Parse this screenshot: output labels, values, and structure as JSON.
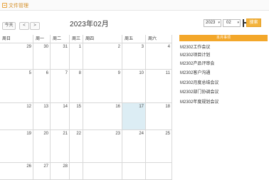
{
  "window": {
    "title": "文件管理"
  },
  "nav": {
    "today": "今天",
    "prev": "<",
    "next": ">"
  },
  "calendar": {
    "title": "2023年02月",
    "weekdays": [
      "周日",
      "周一",
      "周二",
      "周三",
      "周四",
      "周五",
      "周六"
    ],
    "weeks": [
      [
        {
          "d": "29"
        },
        {
          "d": "30"
        },
        {
          "d": "31"
        },
        {
          "d": "1"
        },
        {
          "d": "2"
        },
        {
          "d": "3"
        },
        {
          "d": "4"
        }
      ],
      [
        {
          "d": "5"
        },
        {
          "d": "6"
        },
        {
          "d": "7"
        },
        {
          "d": "8"
        },
        {
          "d": "9"
        },
        {
          "d": "10"
        },
        {
          "d": "11"
        }
      ],
      [
        {
          "d": "12"
        },
        {
          "d": "13"
        },
        {
          "d": "14"
        },
        {
          "d": "15"
        },
        {
          "d": "16"
        },
        {
          "d": "17",
          "today": true
        },
        {
          "d": "18"
        }
      ],
      [
        {
          "d": "19"
        },
        {
          "d": "20"
        },
        {
          "d": "21"
        },
        {
          "d": "22"
        },
        {
          "d": "23"
        },
        {
          "d": "24"
        },
        {
          "d": "25"
        }
      ],
      [
        {
          "d": "26"
        },
        {
          "d": "27"
        },
        {
          "d": "28"
        },
        {
          "d": ""
        },
        {
          "d": ""
        },
        {
          "d": ""
        },
        {
          "d": ""
        }
      ]
    ]
  },
  "filters": {
    "year": "2023",
    "month": "02",
    "search": "搜索"
  },
  "panel": {
    "header": "本月事项",
    "events": [
      "M2302工作会议",
      "M2302项目计划",
      "M2302产品评审会",
      "M2302客户沟通",
      "M2302月度总结会议",
      "M2302部门协调会议",
      "M2302年度规划会议"
    ]
  },
  "colors": {
    "accent": "#f3a72a",
    "today_bg": "#dcedf4",
    "lunar": "#d9534f"
  }
}
